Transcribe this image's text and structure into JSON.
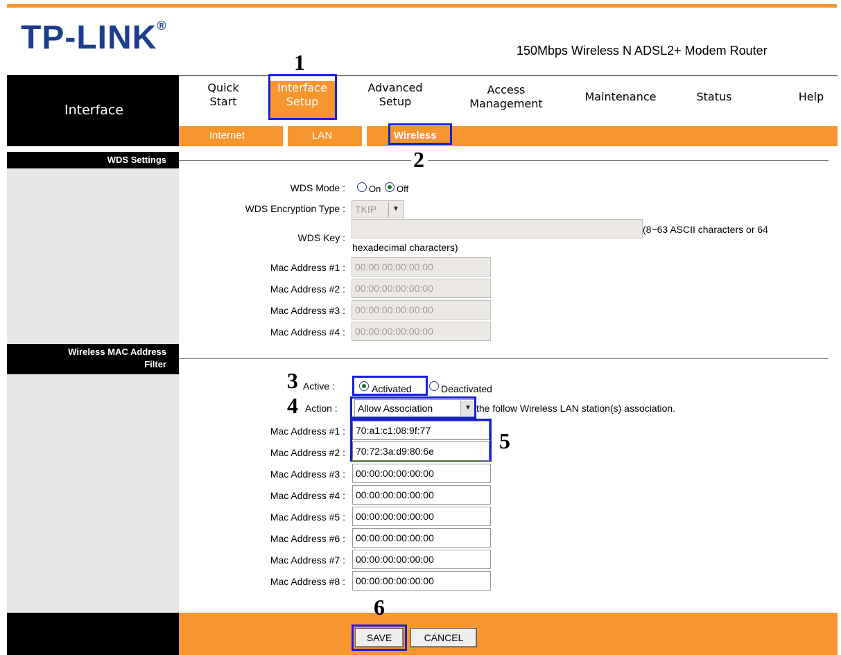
{
  "header": {
    "logo": "TP-LINK",
    "logo_mark": "®",
    "model": "150Mbps Wireless N ADSL2+ Modem Router"
  },
  "nav": {
    "left_label": "Interface",
    "tabs": [
      {
        "line1": "Quick",
        "line2": "Start"
      },
      {
        "line1": "Interface",
        "line2": "Setup"
      },
      {
        "line1": "Advanced",
        "line2": "Setup"
      },
      {
        "line1": "Access",
        "line2": "Management"
      },
      {
        "line1": "Maintenance",
        "line2": ""
      },
      {
        "line1": "Status",
        "line2": ""
      },
      {
        "line1": "Help",
        "line2": ""
      }
    ],
    "subtabs": [
      "Internet",
      "LAN",
      "Wireless"
    ]
  },
  "annotations": [
    "1",
    "2",
    "3",
    "4",
    "5",
    "6"
  ],
  "wds": {
    "title": "WDS Settings",
    "mode_label": "WDS Mode :",
    "mode_on": "On",
    "mode_off": "Off",
    "enc_label": "WDS Encryption Type :",
    "enc_value": "TKIP",
    "key_label": "WDS Key :",
    "key_value": "",
    "key_hint": "(8~63 ASCII characters or 64",
    "key_hint2": "hexadecimal characters)",
    "macs": [
      {
        "label": "Mac Address #1 :",
        "value": "00:00:00:00:00:00"
      },
      {
        "label": "Mac Address #2 :",
        "value": "00:00:00:00:00:00"
      },
      {
        "label": "Mac Address #3 :",
        "value": "00:00:00:00:00:00"
      },
      {
        "label": "Mac Address #4 :",
        "value": "00:00:00:00:00:00"
      }
    ]
  },
  "filter": {
    "title_line1": "Wireless MAC Address",
    "title_line2": "Filter",
    "active_label": "Active :",
    "activated": "Activated",
    "deactivated": "Deactivated",
    "action_label": "Action :",
    "action_value": "Allow Association",
    "action_hint": "the follow Wireless LAN station(s) association.",
    "macs": [
      {
        "label": "Mac Address #1 :",
        "value": "70:a1:c1:08:9f:77"
      },
      {
        "label": "Mac Address #2 :",
        "value": "70:72:3a:d9:80:6e"
      },
      {
        "label": "Mac Address #3 :",
        "value": "00:00:00:00:00:00"
      },
      {
        "label": "Mac Address #4 :",
        "value": "00:00:00:00:00:00"
      },
      {
        "label": "Mac Address #5 :",
        "value": "00:00:00:00:00:00"
      },
      {
        "label": "Mac Address #6 :",
        "value": "00:00:00:00:00:00"
      },
      {
        "label": "Mac Address #7 :",
        "value": "00:00:00:00:00:00"
      },
      {
        "label": "Mac Address #8 :",
        "value": "00:00:00:00:00:00"
      }
    ]
  },
  "footer": {
    "save": "SAVE",
    "cancel": "CANCEL"
  },
  "colors": {
    "accent": "#f7962e",
    "annotation": "#1420d8",
    "logo": "#1d3d8f"
  }
}
